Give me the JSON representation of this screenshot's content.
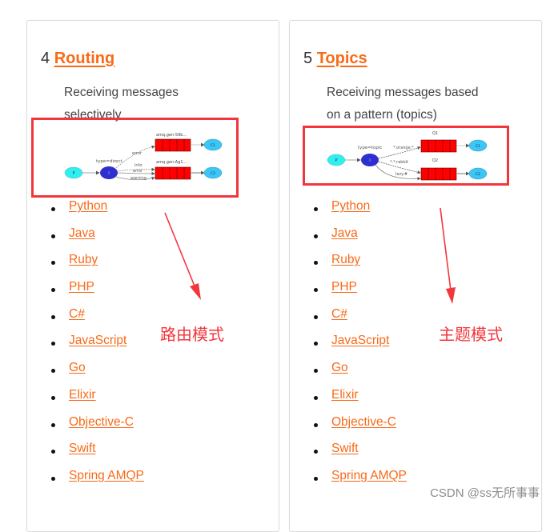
{
  "colors": {
    "link": "#f86a18",
    "annotation": "#f2373c",
    "text": "#333333"
  },
  "cards": [
    {
      "number": "4",
      "title": "Routing",
      "description": "Receiving messages selectively",
      "diagram": {
        "producer": "P",
        "exchange": "X",
        "exchange_label": "type=direct",
        "queues": [
          "amq.gen-S9b...",
          "amq.gen-Ag1..."
        ],
        "bindings": [
          "error",
          "info",
          "error",
          "warning"
        ],
        "consumers": [
          "C1",
          "C2"
        ]
      },
      "languages": [
        "Python",
        "Java",
        "Ruby",
        "PHP",
        "C#",
        "JavaScript",
        "Go",
        "Elixir",
        "Objective-C",
        "Swift",
        "Spring AMQP"
      ],
      "annotation": "路由模式"
    },
    {
      "number": "5",
      "title": "Topics",
      "description": "Receiving messages based on a pattern (topics)",
      "diagram": {
        "producer": "P",
        "exchange": "X",
        "exchange_label": "type=topic",
        "queues": [
          "Q1",
          "Q2"
        ],
        "bindings": [
          "*.orange.*",
          "*.*.rabbit",
          "lazy.#"
        ],
        "consumers": [
          "C1",
          "C2"
        ]
      },
      "languages": [
        "Python",
        "Java",
        "Ruby",
        "PHP",
        "C#",
        "JavaScript",
        "Go",
        "Elixir",
        "Objective-C",
        "Swift",
        "Spring AMQP"
      ],
      "annotation": "主题模式"
    }
  ],
  "watermark": "CSDN @ss无所事事"
}
